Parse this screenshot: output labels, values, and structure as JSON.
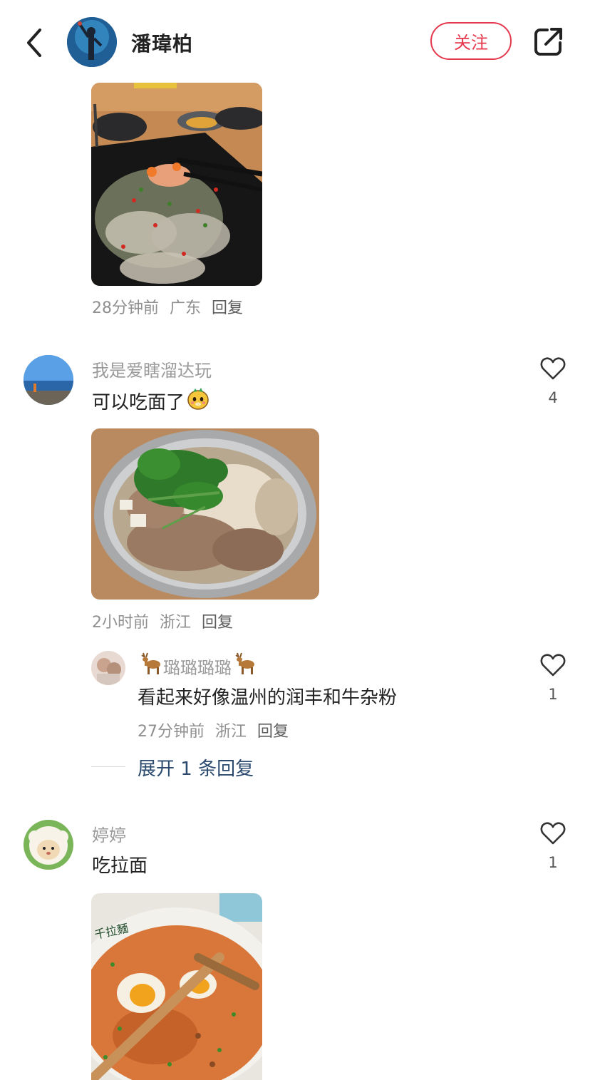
{
  "header": {
    "back_icon": "chevron-left-icon",
    "author_name": "潘瑋柏",
    "follow_label": "关注",
    "share_icon": "share-icon",
    "follow_color": "#e5384d"
  },
  "post": {
    "time": "28分钟前",
    "location": "广东",
    "reply_label": "回复"
  },
  "comments": [
    {
      "username": "我是爱瞎溜达玩",
      "text": "可以吃面了",
      "emoji_icon": "cute-face-emoji-icon",
      "like_count": "4",
      "time": "2小时前",
      "location": "浙江",
      "reply_label": "回复",
      "replies": [
        {
          "username": "璐璐璐璐",
          "username_icons": [
            "deer-icon",
            "deer-icon"
          ],
          "text": "看起来好像温州的润丰和牛杂粉",
          "like_count": "1",
          "time": "27分钟前",
          "location": "浙江",
          "reply_label": "回复"
        }
      ],
      "expand_label": "展开 1 条回复"
    },
    {
      "username": "婷婷",
      "text": "吃拉面",
      "like_count": "1",
      "image_text": "千拉麵"
    }
  ],
  "colors": {
    "accent": "#e5384d",
    "link": "#2b4a6e"
  }
}
